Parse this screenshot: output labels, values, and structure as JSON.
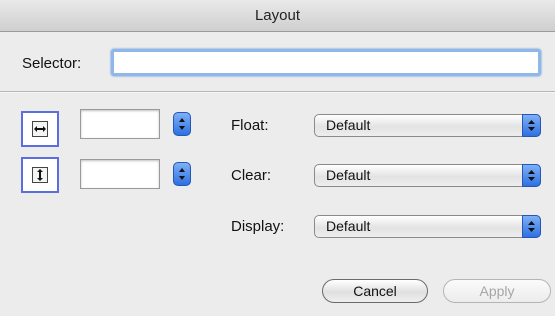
{
  "window": {
    "title": "Layout"
  },
  "selector": {
    "label": "Selector:",
    "value": ""
  },
  "width_field": {
    "value": ""
  },
  "height_field": {
    "value": ""
  },
  "float": {
    "label": "Float:",
    "selected": "Default"
  },
  "clear": {
    "label": "Clear:",
    "selected": "Default"
  },
  "display": {
    "label": "Display:",
    "selected": "Default"
  },
  "buttons": {
    "cancel": "Cancel",
    "apply": "Apply"
  },
  "colors": {
    "accent_blue": "#2d70e2",
    "focus_ring": "#8fb7ea",
    "icon_border": "#5b6ee0"
  }
}
